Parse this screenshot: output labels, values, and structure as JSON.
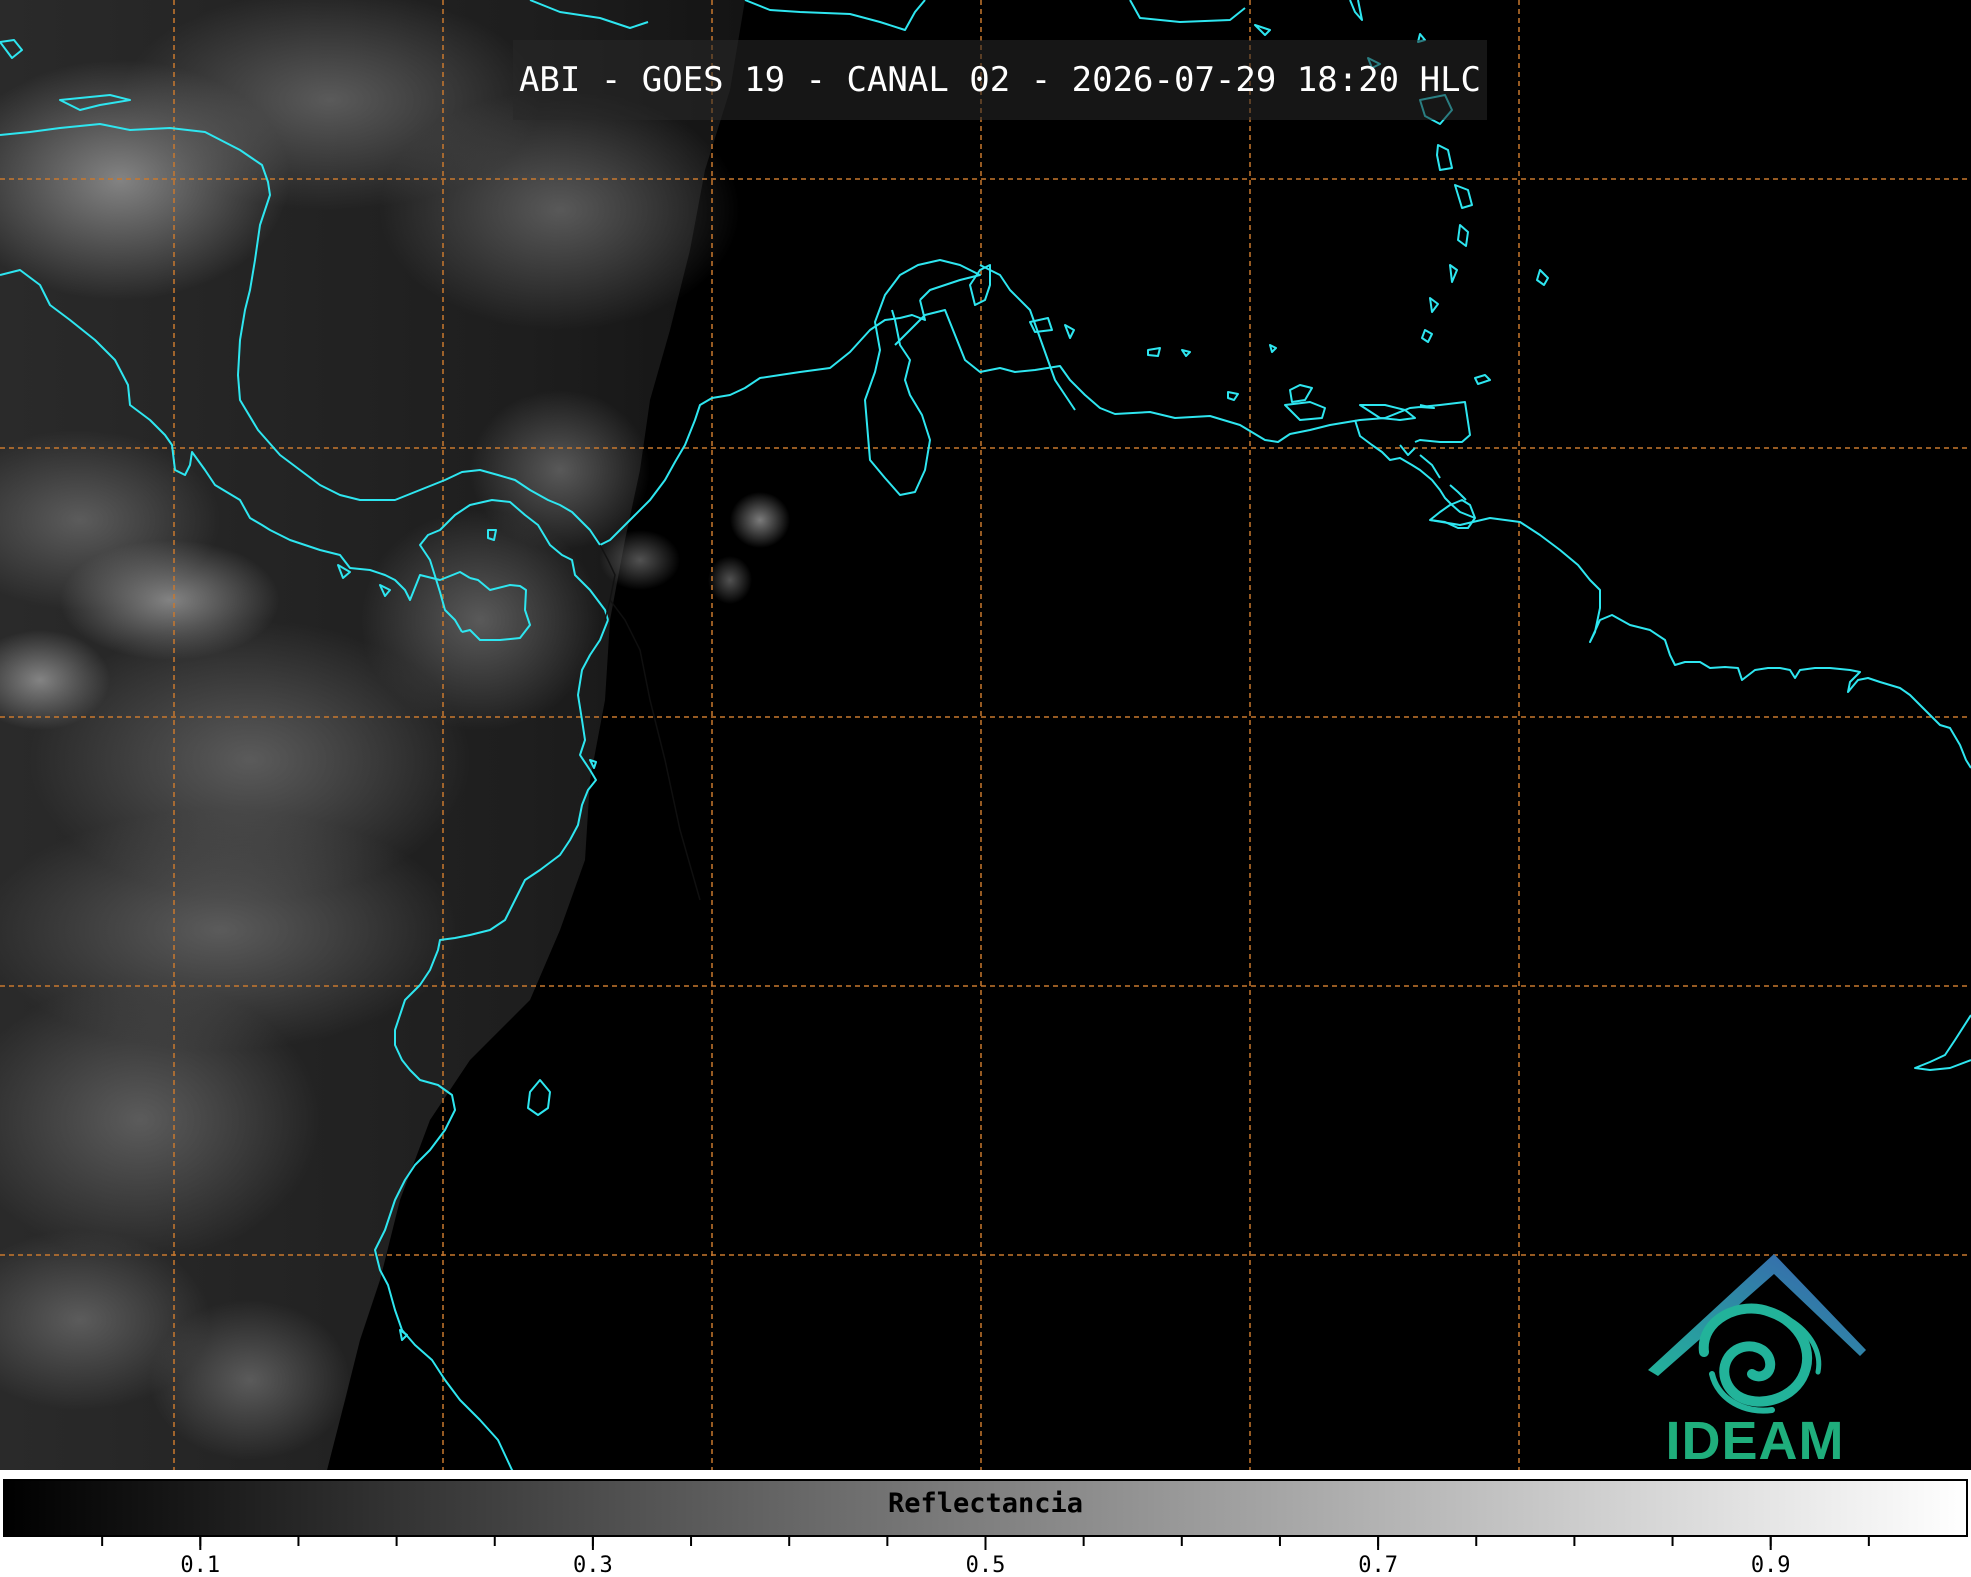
{
  "title": "ABI - GOES 19 - CANAL 02 - 2026-07-29 18:20 HLC",
  "logo": {
    "text": "IDEAM",
    "colors": {
      "roof": "#3a6fb0",
      "swirl": "#22b39a",
      "text": "#1fae7c"
    }
  },
  "map": {
    "colors": {
      "coastline": "#2ee6f0",
      "grid": "#c8782e",
      "background": "#000000"
    },
    "grid": {
      "lines": "dashed"
    }
  },
  "colorbar": {
    "label": "Reflectancia",
    "ticks": [
      "0.1",
      "0.3",
      "0.5",
      "0.7",
      "0.9"
    ],
    "range": [
      0.0,
      1.0
    ],
    "colormap": "grayscale"
  }
}
